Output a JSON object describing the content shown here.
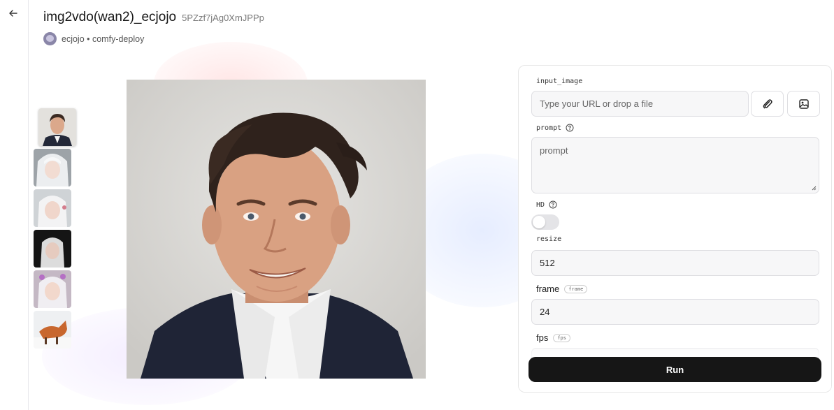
{
  "header": {
    "title": "img2vdo(wan2)_ecjojo",
    "id": "5PZzf7jAg0XmJPPp",
    "owner": "ecjojo • comfy-deploy"
  },
  "icons": {
    "back": "arrow-left-icon",
    "attach": "paperclip-icon",
    "image": "image-icon",
    "help": "help-circle-icon"
  },
  "gallery": {
    "thumbnails": [
      "portrait-of-man-in-suit",
      "white-haired-girl-1",
      "white-haired-girl-2",
      "white-haired-girl-dark",
      "white-haired-girl-flowers",
      "fox-in-snow"
    ],
    "selected_index": 0
  },
  "form": {
    "input_image": {
      "label": "input_image",
      "placeholder": "Type your URL or drop a file"
    },
    "prompt": {
      "label": "prompt",
      "placeholder": "prompt"
    },
    "hd": {
      "label": "HD",
      "enabled": false
    },
    "resize": {
      "label": "resize",
      "value": "512"
    },
    "frame": {
      "label": "frame",
      "tag": "frame",
      "value": "24"
    },
    "fps": {
      "label": "fps",
      "tag": "fps"
    },
    "run_label": "Run"
  },
  "colors": {
    "run_button": "#161616",
    "field_bg": "#f7f7f8",
    "border": "#dedee2"
  }
}
